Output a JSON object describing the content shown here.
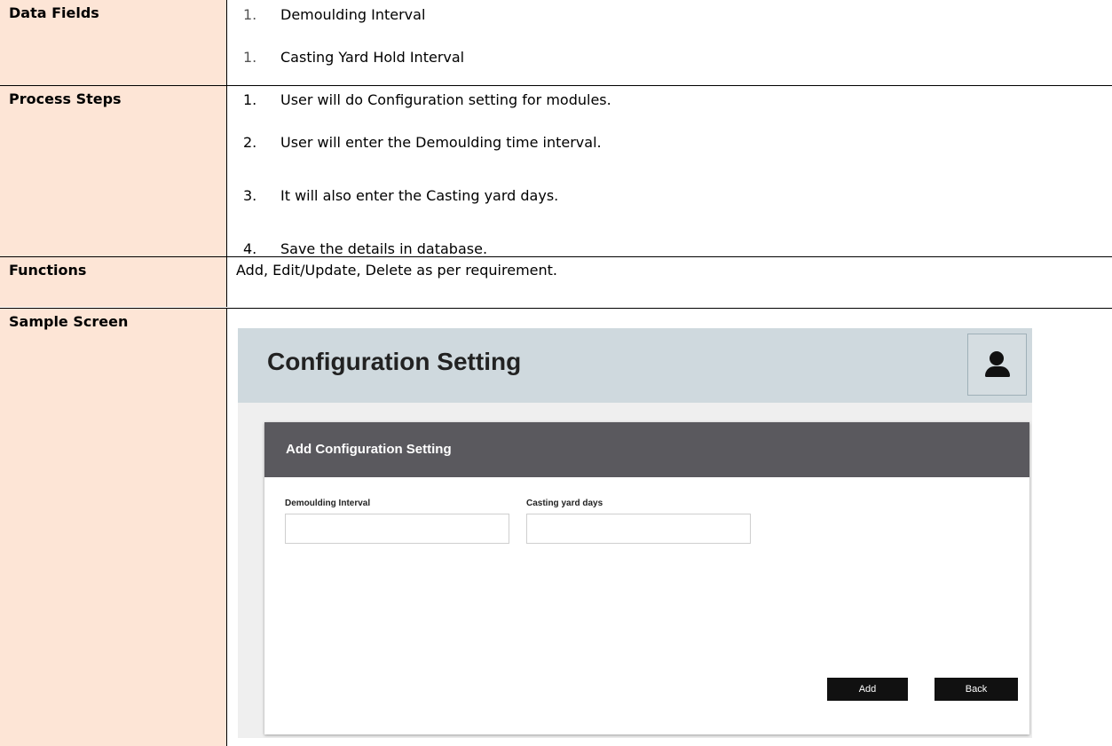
{
  "rows": {
    "data_fields": {
      "label": "Data Fields",
      "items": [
        {
          "num": "1.",
          "text": "Demoulding Interval"
        },
        {
          "num": "1.",
          "text": "Casting Yard Hold Interval"
        }
      ]
    },
    "process_steps": {
      "label": "Process Steps",
      "items": [
        {
          "num": "1.",
          "text": "User will do Configuration setting for modules."
        },
        {
          "num": "2.",
          "text": "User will enter the Demoulding time interval."
        },
        {
          "num": "3.",
          "text": "It will also enter the Casting yard days."
        },
        {
          "num": "4.",
          "text": "Save the details in database."
        }
      ]
    },
    "functions": {
      "label": "Functions",
      "text": "Add, Edit/Update, Delete as per requirement."
    },
    "sample_screen": {
      "label": "Sample Screen"
    }
  },
  "mock": {
    "page_title": "Configuration Setting",
    "user_icon": "user-icon",
    "panel_title": "Add Configuration Setting",
    "fields": {
      "demoulding": {
        "label": "Demoulding Interval",
        "value": "",
        "placeholder": ""
      },
      "casting": {
        "label": "Casting yard days",
        "value": "",
        "placeholder": ""
      }
    },
    "buttons": {
      "add": "Add",
      "back": "Back"
    }
  },
  "colors": {
    "label_bg": "#fde5d6",
    "header_bg": "#cfd9de",
    "panel_head_bg": "#5a595e",
    "button_bg": "#111111"
  }
}
